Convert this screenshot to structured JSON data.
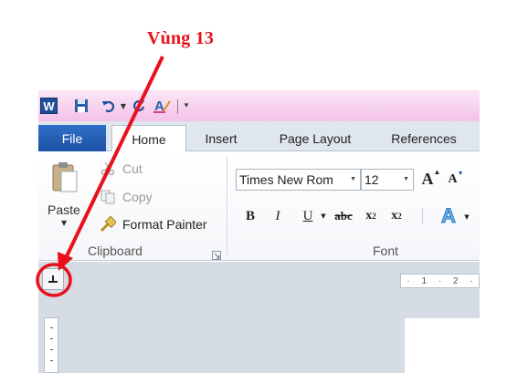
{
  "annotation": {
    "label": "Vùng 13",
    "color": "#e8111b"
  },
  "quick_access": {
    "app_icon_letter": "W",
    "icons": [
      "save-icon",
      "undo-icon",
      "redo-icon",
      "format-icon",
      "customize-icon"
    ]
  },
  "tabs": {
    "file": "File",
    "home": "Home",
    "insert": "Insert",
    "page_layout": "Page Layout",
    "references": "References"
  },
  "clipboard": {
    "paste": "Paste",
    "cut": "Cut",
    "copy": "Copy",
    "format_painter": "Format Painter",
    "group_label": "Clipboard"
  },
  "font": {
    "font_name": "Times New Rom",
    "font_size": "12",
    "grow": "A",
    "shrink": "A",
    "bold": "B",
    "italic": "I",
    "underline": "U",
    "strikethrough": "abc",
    "subscript": "x",
    "subscript_mark": "2",
    "superscript": "x",
    "superscript_mark": "2",
    "text_effects": "A",
    "group_label": "Font"
  },
  "ruler": {
    "marks": [
      "1",
      "2"
    ]
  },
  "colors": {
    "file_tab": "#1d52a4",
    "qat_bg": "#f3c2e8",
    "annotation": "#e8111b"
  }
}
